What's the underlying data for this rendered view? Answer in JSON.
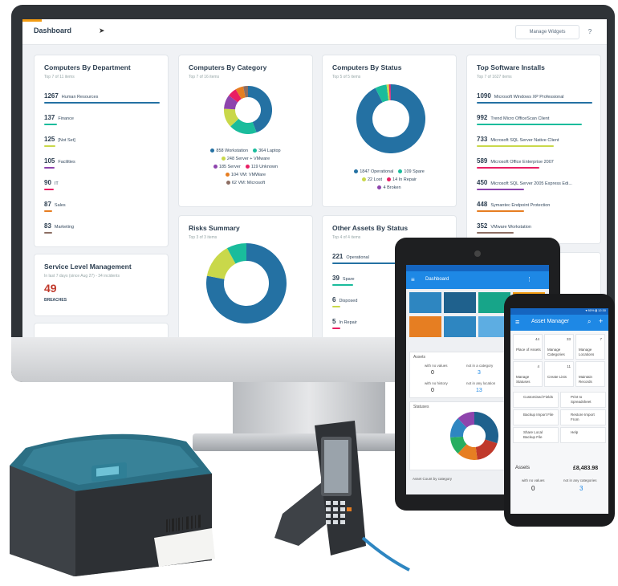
{
  "dashboard": {
    "title": "Dashboard",
    "manage_label": "Manage Widgets",
    "help_label": "?"
  },
  "dept": {
    "title": "Computers By Department",
    "subtitle": "Top 7 of 11 items",
    "items": [
      {
        "value": "1267",
        "label": "Human Resources",
        "color": "#2471a3",
        "frac": 1.0
      },
      {
        "value": "137",
        "label": "Finance",
        "color": "#1abc9c",
        "frac": 0.11
      },
      {
        "value": "125",
        "label": "[Not Set]",
        "color": "#c9d84a",
        "frac": 0.1
      },
      {
        "value": "105",
        "label": "Facilities",
        "color": "#8e44ad",
        "frac": 0.09
      },
      {
        "value": "90",
        "label": "IT",
        "color": "#e91e63",
        "frac": 0.08
      },
      {
        "value": "87",
        "label": "Sales",
        "color": "#e67e22",
        "frac": 0.07
      },
      {
        "value": "83",
        "label": "Marketing",
        "color": "#8d6e63",
        "frac": 0.07
      }
    ]
  },
  "category": {
    "title": "Computers By Category",
    "subtitle": "Top 7 of 16 items",
    "slices": [
      {
        "label": "858 Workstation",
        "value": 858,
        "color": "#2471a3"
      },
      {
        "label": "364 Laptop",
        "value": 364,
        "color": "#1abc9c"
      },
      {
        "label": "248 Server + VMware",
        "value": 248,
        "color": "#c9d84a"
      },
      {
        "label": "185 Server",
        "value": 185,
        "color": "#8e44ad"
      },
      {
        "label": "119 Unknown",
        "value": 119,
        "color": "#e91e63"
      },
      {
        "label": "104 VM: VMWare",
        "value": 104,
        "color": "#e67e22"
      },
      {
        "label": "62 VM: Microsoft",
        "value": 62,
        "color": "#8d6e63"
      }
    ]
  },
  "status": {
    "title": "Computers By Status",
    "subtitle": "Top 5 of 5 items",
    "slices": [
      {
        "label": "1847 Operational",
        "value": 1847,
        "color": "#2471a3"
      },
      {
        "label": "109 Spare",
        "value": 109,
        "color": "#1abc9c"
      },
      {
        "label": "22 Lost",
        "value": 22,
        "color": "#c9d84a"
      },
      {
        "label": "14 In Repair",
        "value": 14,
        "color": "#e91e63"
      },
      {
        "label": "4 Broken",
        "value": 4,
        "color": "#8e44ad"
      }
    ]
  },
  "software": {
    "title": "Top Software Installs",
    "subtitle": "Top 7 of 1627 items",
    "items": [
      {
        "value": "1090",
        "label": "Microsoft Windows XP Professional",
        "color": "#2471a3",
        "frac": 1.0
      },
      {
        "value": "992",
        "label": "Trend Micro OfficeScan Client",
        "color": "#1abc9c",
        "frac": 0.91
      },
      {
        "value": "733",
        "label": "Microsoft SQL Server Native Client",
        "color": "#c9d84a",
        "frac": 0.67
      },
      {
        "value": "589",
        "label": "Microsoft Office Enterprise 2007",
        "color": "#e91e63",
        "frac": 0.54
      },
      {
        "value": "450",
        "label": "Microsoft SQL Server 2005 Express Edi...",
        "color": "#8e44ad",
        "frac": 0.41
      },
      {
        "value": "448",
        "label": "Symantec Endpoint Protection",
        "color": "#e67e22",
        "frac": 0.41
      },
      {
        "value": "352",
        "label": "VMware Workstation",
        "color": "#8d6e63",
        "frac": 0.32
      }
    ]
  },
  "slm": {
    "title": "Service Level Management",
    "subtitle": "In last 7 days (since Aug 27) - 34 incidents",
    "value": "49",
    "caption": "BREACHES"
  },
  "risks": {
    "title": "Risks Summary",
    "subtitle": "Top 3 of 3 items",
    "slices": [
      {
        "value": 78,
        "color": "#2471a3"
      },
      {
        "value": 14,
        "color": "#c9d84a"
      },
      {
        "value": 8,
        "color": "#1abc9c"
      }
    ]
  },
  "other": {
    "title": "Other Assets By Status",
    "subtitle": "Top 4 of 4 items",
    "items": [
      {
        "value": "221",
        "label": "Operational",
        "color": "#2471a3",
        "frac": 1.0
      },
      {
        "value": "39",
        "label": "Spare",
        "color": "#1abc9c",
        "frac": 0.18
      },
      {
        "value": "6",
        "label": "Disposed",
        "color": "#c9d84a",
        "frac": 0.05
      },
      {
        "value": "5",
        "label": "In Repair",
        "color": "#e91e63",
        "frac": 0.04
      }
    ]
  },
  "tablet": {
    "title": "Dashboard",
    "tiles": [
      "#2e86c1",
      "#1f618d",
      "#17a589",
      "#f39c12",
      "#e67e22",
      "#2e86c1",
      "#5dade2",
      "#1abc9c"
    ],
    "assets_label": "Assets",
    "stat_a_label": "with no values",
    "stat_a": "0",
    "stat_b_label": "not in a category",
    "stat_b": "3",
    "stat_c_label": "with no history",
    "stat_c": "0",
    "stat_d_label": "not in any location",
    "stat_d": "13",
    "statuses_label": "Statuses",
    "donut": [
      {
        "value": 30,
        "color": "#1f618d"
      },
      {
        "value": 18,
        "color": "#c0392b"
      },
      {
        "value": 14,
        "color": "#e67e22"
      },
      {
        "value": 12,
        "color": "#27ae60"
      },
      {
        "value": 14,
        "color": "#2e86c1"
      },
      {
        "value": 12,
        "color": "#8e44ad"
      }
    ],
    "footer": "Asset Count by category"
  },
  "phone": {
    "status": "▾ 80% ▮ 12:30",
    "title": "Asset Manager",
    "grid": [
      {
        "count": "44",
        "label": "Place of Assets"
      },
      {
        "count": "33",
        "label": "Manage Categories"
      },
      {
        "count": "7",
        "label": "Manage Locations"
      },
      {
        "count": "4",
        "label": "Manage Statuses"
      },
      {
        "count": "11",
        "label": "Create Lists"
      },
      {
        "count": "",
        "label": "Maintain Records"
      }
    ],
    "actions": [
      "Customised Fields",
      "Print to Spreadsheet",
      "Backup Import File",
      "Restore Import From",
      "Share Local Backup File",
      "Help"
    ],
    "assets_label": "Assets",
    "assets_value": "£8,483.98",
    "stat_a_label": "with no values",
    "stat_a": "0",
    "stat_b_label": "not in any categories",
    "stat_b": "3"
  }
}
